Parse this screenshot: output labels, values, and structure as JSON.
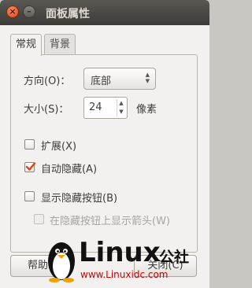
{
  "window": {
    "title": "面板属性"
  },
  "tabs": [
    {
      "label": "常规",
      "selected": true
    },
    {
      "label": "背景",
      "selected": false
    }
  ],
  "orientation": {
    "label": "方向(O)：",
    "value": "底部"
  },
  "size": {
    "label": "大小(S)：",
    "value": "24",
    "unit": "像素"
  },
  "options": {
    "expand": {
      "label": "扩展(X)",
      "checked": false
    },
    "autohide": {
      "label": "自动隐藏(A)",
      "checked": true
    },
    "show_hide_buttons": {
      "label": "显示隐藏按钮(B)",
      "checked": false
    },
    "arrows_on_hide_buttons": {
      "label": "在隐藏按钮上显示箭头(W)",
      "checked": false,
      "enabled": false
    }
  },
  "buttons": {
    "help": "帮助",
    "close": "关闭(C)"
  },
  "watermark": {
    "logo_text": "Linux",
    "logo_cn": "公社",
    "url": "www.Linuxidc.com"
  },
  "colors": {
    "checkmark": "#d64a16",
    "titlebar": "#3c3b37",
    "close_button": "#df4a16",
    "watermark_red": "#cc0000"
  }
}
